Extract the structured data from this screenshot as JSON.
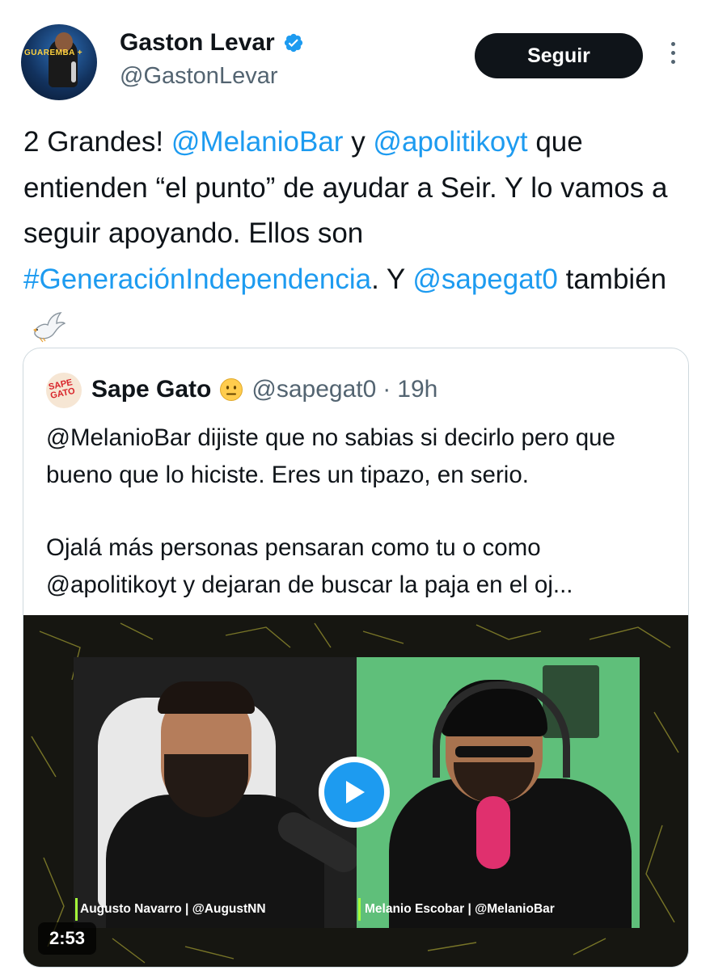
{
  "author": {
    "name": "Gaston Levar",
    "handle": "@GastonLevar",
    "avatar_text": "GUAREMBA +",
    "verified_icon": "verified-badge-icon",
    "verified_color": "#1d9bf0"
  },
  "follow_button": {
    "label": "Seguir"
  },
  "more_icon": "more-vertical-icon",
  "tweet": {
    "segments": [
      {
        "text": "2 Grandes! ",
        "link": false
      },
      {
        "text": "@MelanioBar",
        "link": true
      },
      {
        "text": " y ",
        "link": false
      },
      {
        "text": "@apolitikoyt",
        "link": true
      },
      {
        "text": " que entienden “el punto” de ayudar a Seir. Y lo vamos a seguir apoyando. Ellos son ",
        "link": false
      },
      {
        "text": "#GeneraciónIndependencia",
        "link": true
      },
      {
        "text": ". Y ",
        "link": false
      },
      {
        "text": "@sapegat0",
        "link": true
      },
      {
        "text": " también",
        "link": false
      }
    ],
    "trailing_emoji": "dove-emoji",
    "link_color": "#1d9bf0"
  },
  "quoted": {
    "name": "Sape Gato",
    "emoji": "neutral-face-emoji",
    "handle": "@sapegat0",
    "separator": "·",
    "time": "19h",
    "avatar_text": "SAPE GATO",
    "text_p1": "@MelanioBar dijiste que no sabias si decirlo pero que bueno que lo hiciste. Eres un tipazo, en serio.",
    "text_p2": "Ojalá más personas pensaran como tu o como @apolitikoyt y dejaran de buscar la paja en el oj..."
  },
  "video": {
    "caption_left": "Augusto Navarro | @AugustNN",
    "caption_right": "Melanio Escobar | @MelanioBar",
    "duration": "2:53",
    "play_icon": "play-icon",
    "accent_color": "#a6ff3a"
  }
}
